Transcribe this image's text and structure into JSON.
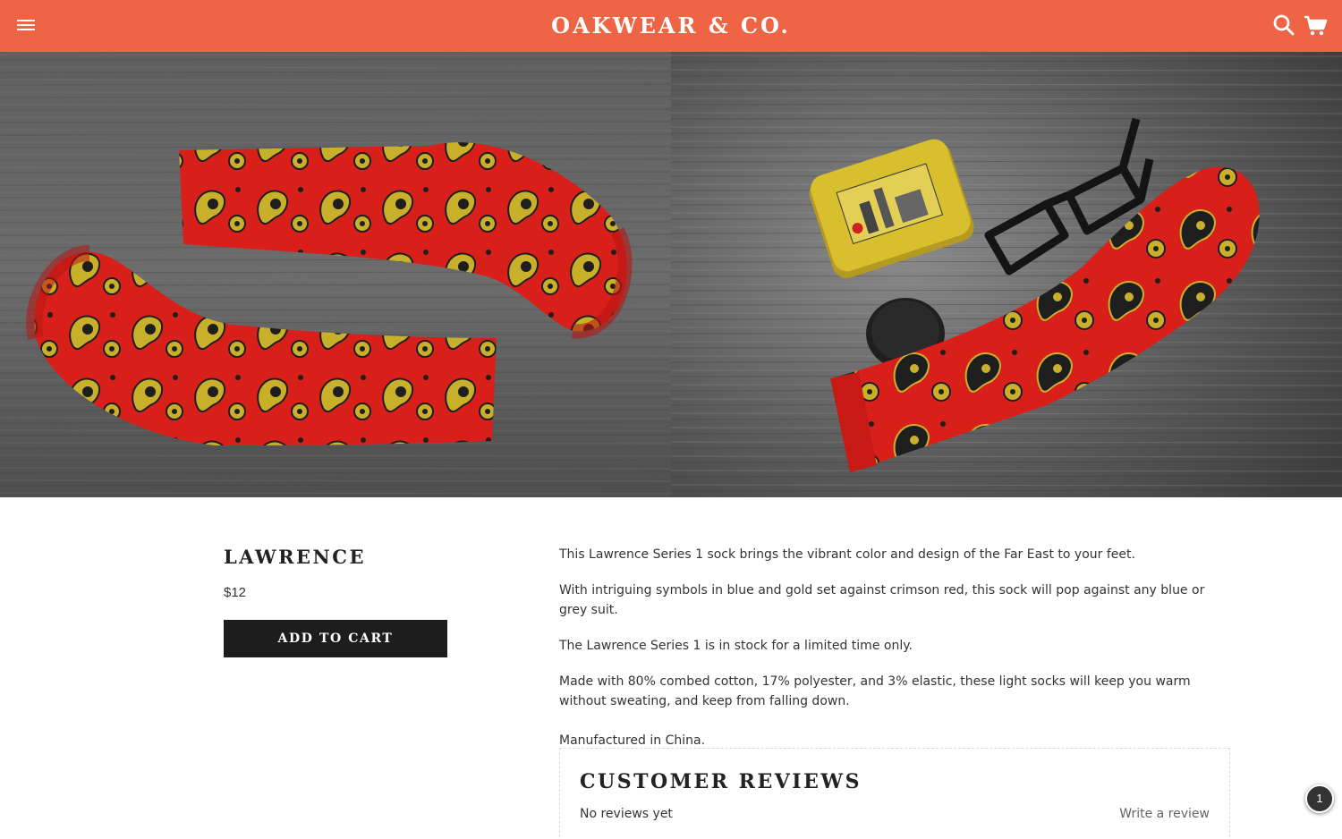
{
  "header": {
    "brand": "OAKWEAR & CO.",
    "background": "#ef6444",
    "icons": [
      "menu-icon",
      "search-icon",
      "cart-icon"
    ]
  },
  "gallery": {
    "images": [
      "paisley-socks-flat-lay",
      "paisley-sock-with-glasses-and-tin"
    ]
  },
  "product": {
    "title": "LAWRENCE",
    "price": "$12",
    "add_to_cart": "ADD TO CART",
    "description": [
      "This Lawrence Series 1 sock brings the vibrant color and design of the Far East to your feet.",
      "With intriguing symbols in blue and gold set against crimson red, this sock will pop against any blue or grey suit.",
      "The Lawrence Series 1 is in stock for a limited time only.",
      "Made with 80% combed cotton, 17% polyester, and 3% elastic, these light socks will keep you warm without sweating, and keep from falling down.",
      "Manufactured in China."
    ]
  },
  "reviews": {
    "title": "CUSTOMER REVIEWS",
    "empty_text": "No reviews yet",
    "write_link": "Write a review"
  },
  "badge": {
    "count": "1"
  }
}
